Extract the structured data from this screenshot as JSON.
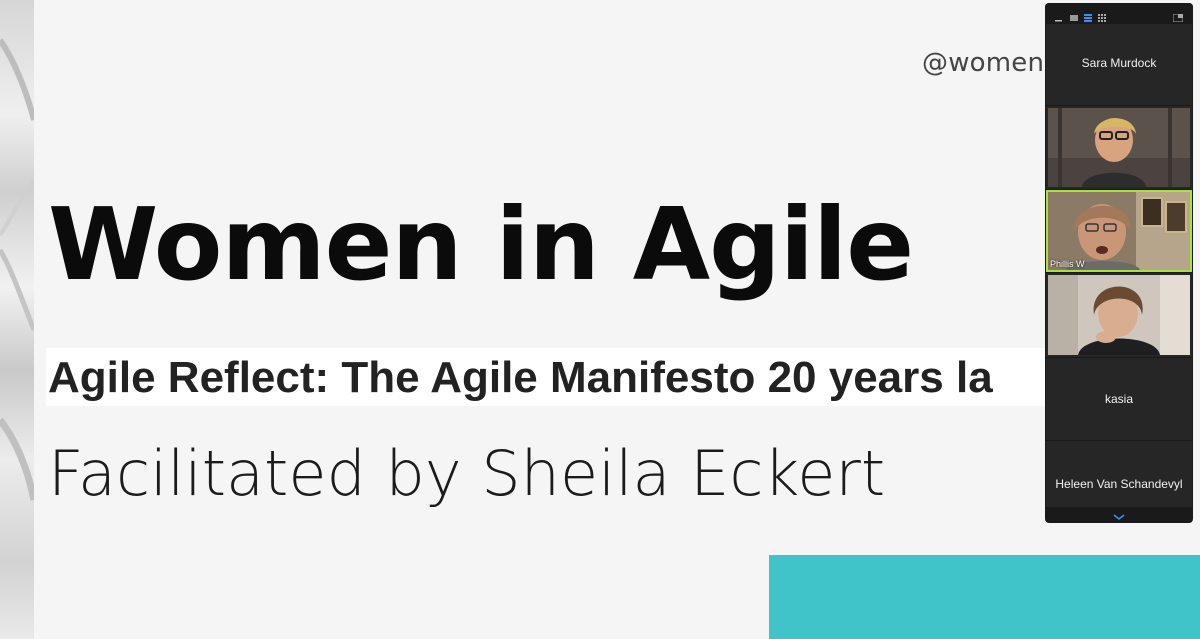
{
  "slide": {
    "handle": "@womenin",
    "title": "Women in Agile",
    "subtitle": "Agile Reflect: The Agile Manifesto 20 years la",
    "facilitator": "Facilitated by Sheila Eckert",
    "colors": {
      "accent_teal": "#40c4c9",
      "title": "#0b0b0b"
    }
  },
  "panel": {
    "toolbar_icons": [
      "minimize-icon",
      "single-view-icon",
      "strip-view-icon",
      "grid-view-icon",
      "fullscreen-icon"
    ],
    "participants": [
      {
        "name": "Sara Murdock",
        "video": false
      },
      {
        "name": "",
        "video": true,
        "active": false
      },
      {
        "name": "Phillis W",
        "video": true,
        "active": true
      },
      {
        "name": "",
        "video": true,
        "active": false
      },
      {
        "name": "kasia",
        "video": false
      },
      {
        "name": "Heleen Van Schandevyl",
        "video": false
      }
    ],
    "active_color": "#a8e23a"
  }
}
